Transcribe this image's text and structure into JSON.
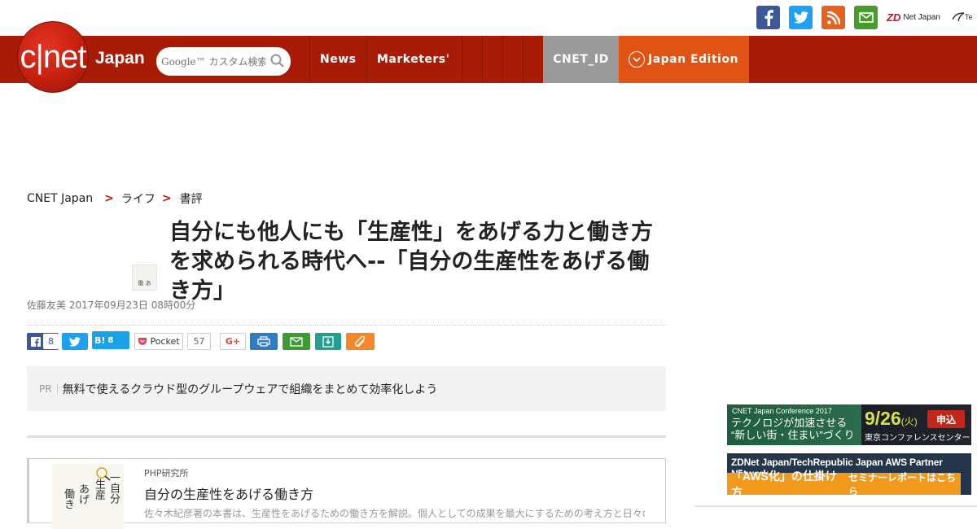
{
  "top_strip": {
    "social": [
      {
        "icon": "facebook-icon",
        "color": "#3b5998",
        "glyph": "f"
      },
      {
        "icon": "twitter-icon",
        "color": "#1da1f2",
        "glyph": ""
      },
      {
        "icon": "rss-icon",
        "color": "#e4621f",
        "glyph": ""
      },
      {
        "icon": "mail-icon",
        "color": "#4b9a2c",
        "glyph": ""
      }
    ],
    "zdnet_logo": "ZD",
    "zdnet_text": "Net Japan",
    "techrepublic_text": "Te"
  },
  "header": {
    "logo_text": "c|net",
    "logo_suffix": "Japan",
    "search_placeholder": "Google™ カスタム検索",
    "nav": [
      {
        "label": "News"
      },
      {
        "label": "Marketers'"
      }
    ],
    "cnet_id_label": "CNET_ID",
    "edition_label": "Japan Edition",
    "brand_red": "#a81c07",
    "edition_orange": "#df5314",
    "id_gray": "#9a9a9a"
  },
  "breadcrumb": {
    "items": [
      "CNET Japan",
      "ライフ",
      "書評"
    ],
    "sep": ">"
  },
  "article": {
    "thumb_text": "働 あ",
    "headline": "自分にも他人にも「生産性」をあげる力と働き方を求められる時代へ--「自分の生産性をあげる働き方」",
    "dateline": "佐藤友美 2017年09月23日 08時00分"
  },
  "share": {
    "facebook_count": "8",
    "hatena_label": "B!",
    "hatena_count": "8",
    "pocket_label": "Pocket",
    "pocket_count": "57",
    "gplus_label": "G+"
  },
  "pr": {
    "tag": "PR",
    "text": "無料で使えるクラウド型のグループウェアで組織をまとめて効率化しよう"
  },
  "book": {
    "cover_lines": [
      "一自分",
      "生産",
      "あげ",
      "働き"
    ],
    "publisher": "PHP研究所",
    "title": "自分の生産性をあげる働き方",
    "description": "佐々木紀彦著の本書は、生産性をあげるための働き方を解説。個人としての成果を最大にするための考え方と日々の習慣を紹介している。"
  },
  "banners": {
    "conf": {
      "label": "CNET Japan Conference 2017",
      "line1": "テクノロジが加速させる",
      "line2": "“新しい街・住まい”づくり",
      "date": "9/26",
      "weekday": "(火)",
      "venue": "東京コンファレンスセンター",
      "apply": "申込"
    },
    "aws": {
      "label": "ZDNet Japan/TechRepublic Japan  AWS Partner Network",
      "main": "「AWS化」の仕掛け方",
      "sub": "セミナーレポートはこちら"
    }
  }
}
